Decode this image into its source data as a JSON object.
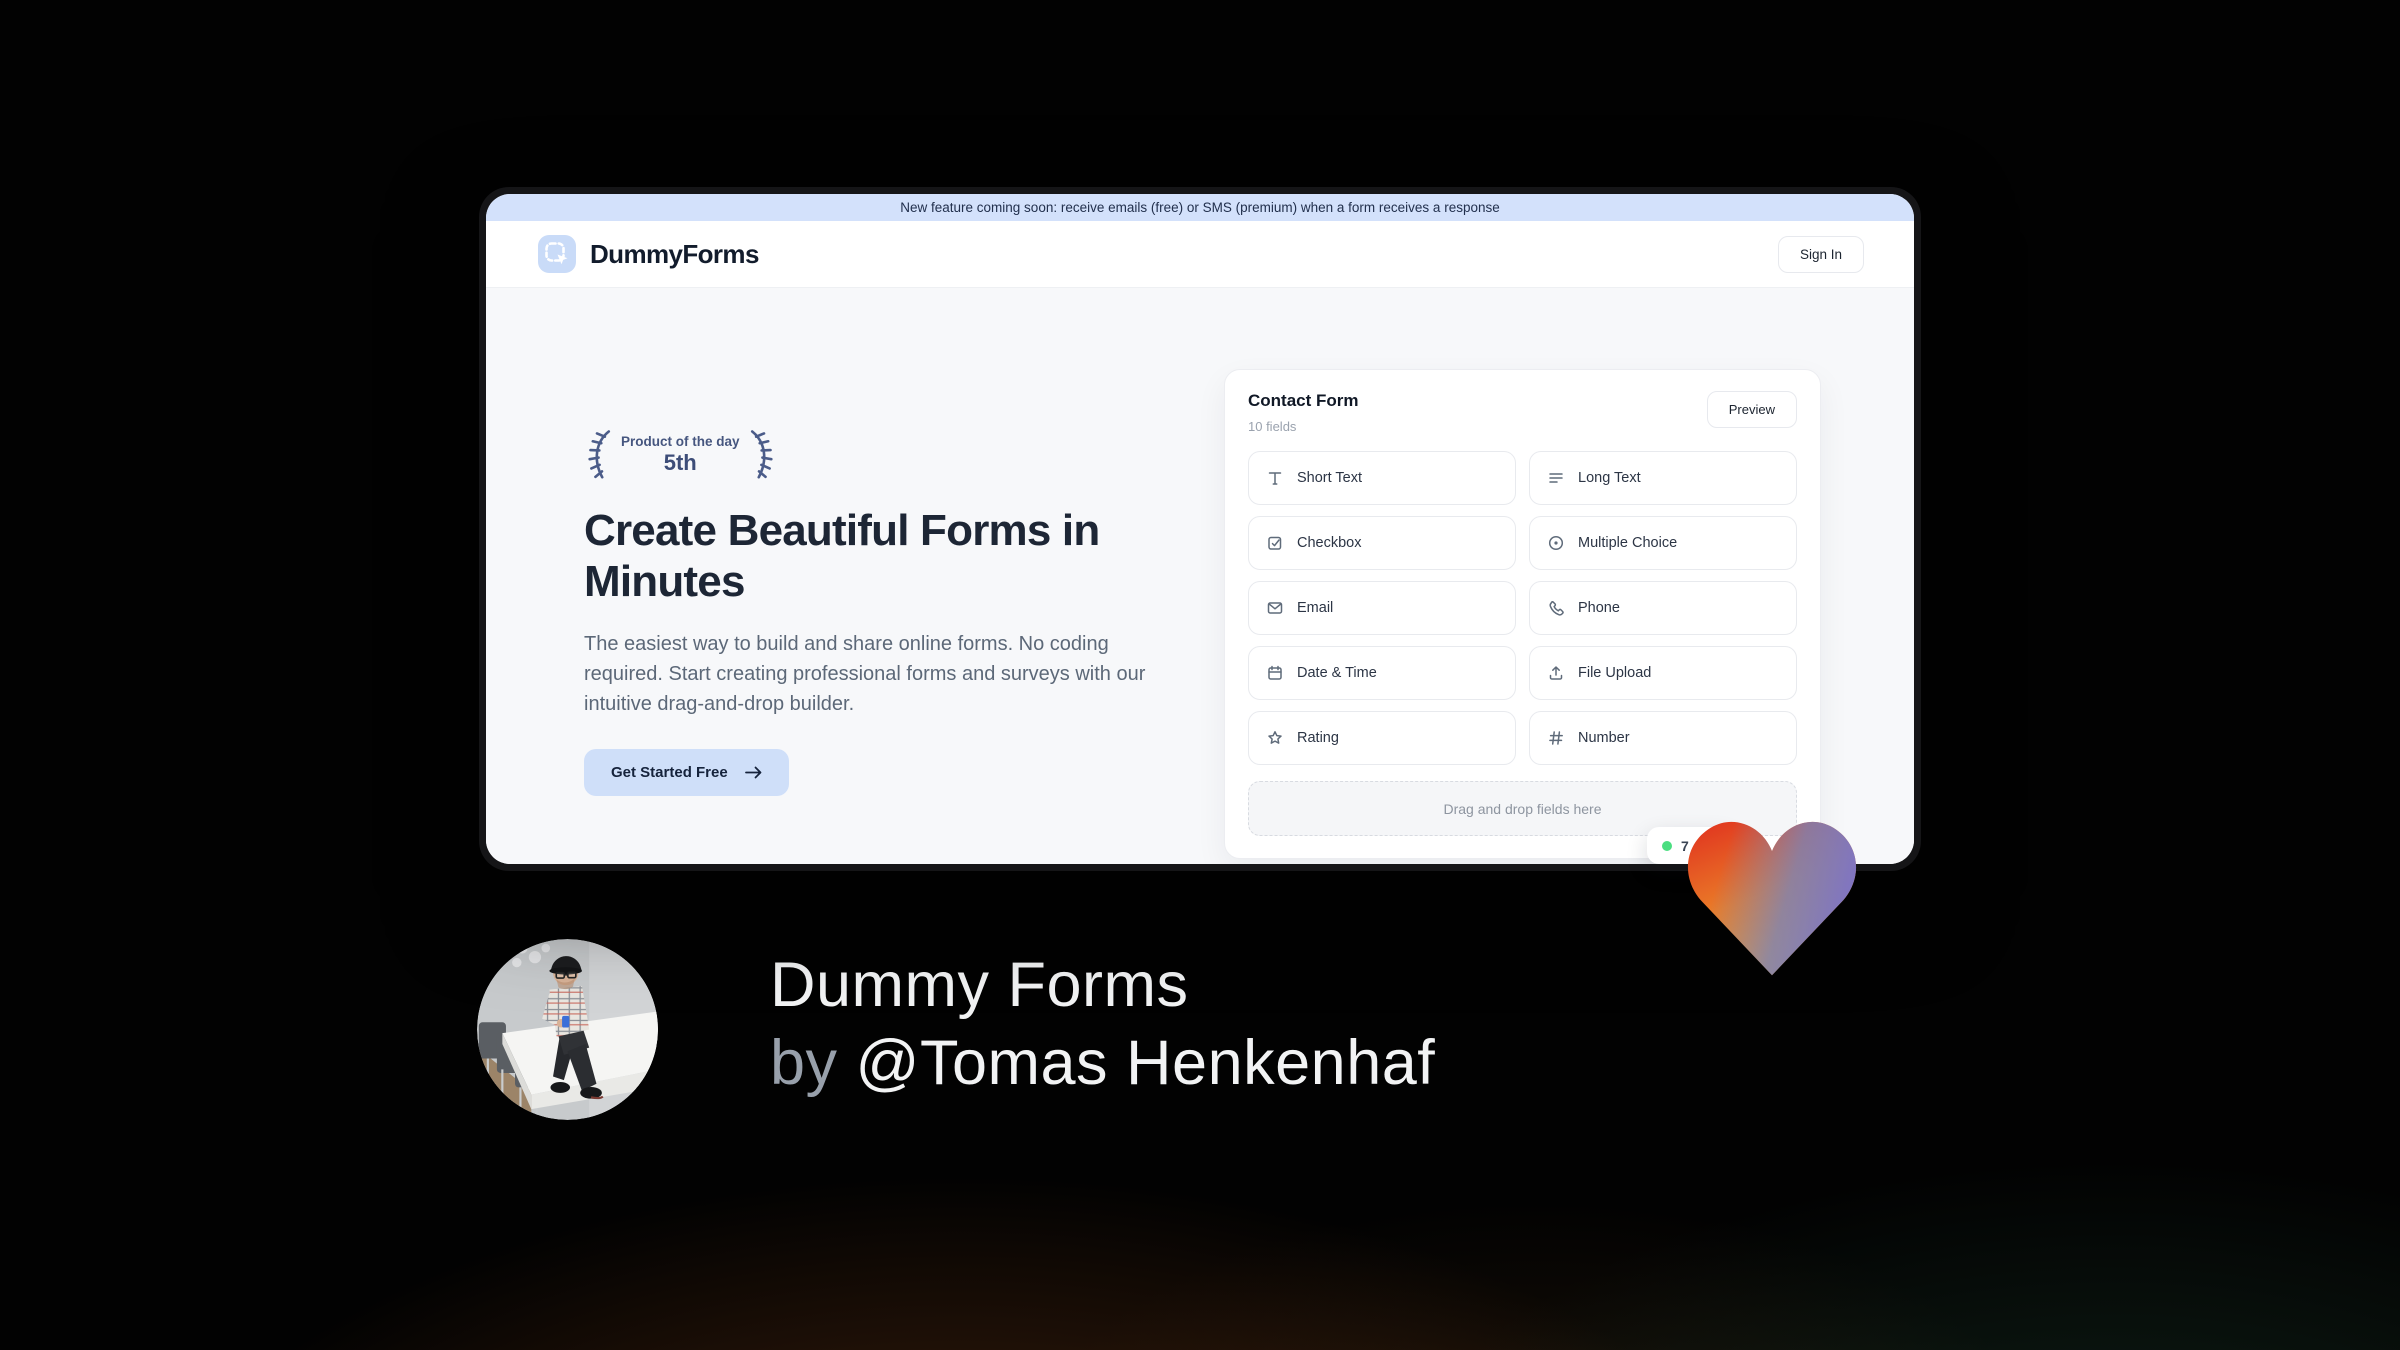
{
  "banner": {
    "text": "New feature coming soon: receive emails (free) or SMS (premium) when a form receives a response"
  },
  "nav": {
    "brand": "DummyForms",
    "sign_in_label": "Sign In"
  },
  "hero": {
    "award": {
      "line1": "Product of the day",
      "line2": "5th"
    },
    "title": "Create Beautiful Forms in Minutes",
    "description": "The easiest way to build and share online forms. No coding required. Start creating professional forms and surveys with our intuitive drag-and-drop builder.",
    "cta_label": "Get Started Free"
  },
  "form_builder": {
    "title": "Contact Form",
    "subtitle": "10 fields",
    "preview_label": "Preview",
    "fields": [
      {
        "label": "Short Text",
        "icon": "short-text-icon"
      },
      {
        "label": "Long Text",
        "icon": "long-text-icon"
      },
      {
        "label": "Checkbox",
        "icon": "checkbox-icon"
      },
      {
        "label": "Multiple Choice",
        "icon": "multiple-choice-icon"
      },
      {
        "label": "Email",
        "icon": "envelope-icon"
      },
      {
        "label": "Phone",
        "icon": "phone-icon"
      },
      {
        "label": "Date & Time",
        "icon": "calendar-icon"
      },
      {
        "label": "File Upload",
        "icon": "upload-icon"
      },
      {
        "label": "Rating",
        "icon": "star-icon"
      },
      {
        "label": "Number",
        "icon": "hash-icon"
      }
    ],
    "dropzone_text": "Drag and drop fields here",
    "live_badge": {
      "count": "7"
    }
  },
  "footer": {
    "title": "Dummy Forms",
    "byline_prefix": "by ",
    "byline_author": "@Tomas Henkenhaf"
  },
  "colors": {
    "banner_bg": "#d3e1fb",
    "accent_blue": "#cfdff9",
    "award_slate": "#46567f",
    "live_dot_green": "#4ade80",
    "heart_red": "#e0301f",
    "heart_orange": "#f0a030",
    "heart_blue": "#7282c2"
  }
}
